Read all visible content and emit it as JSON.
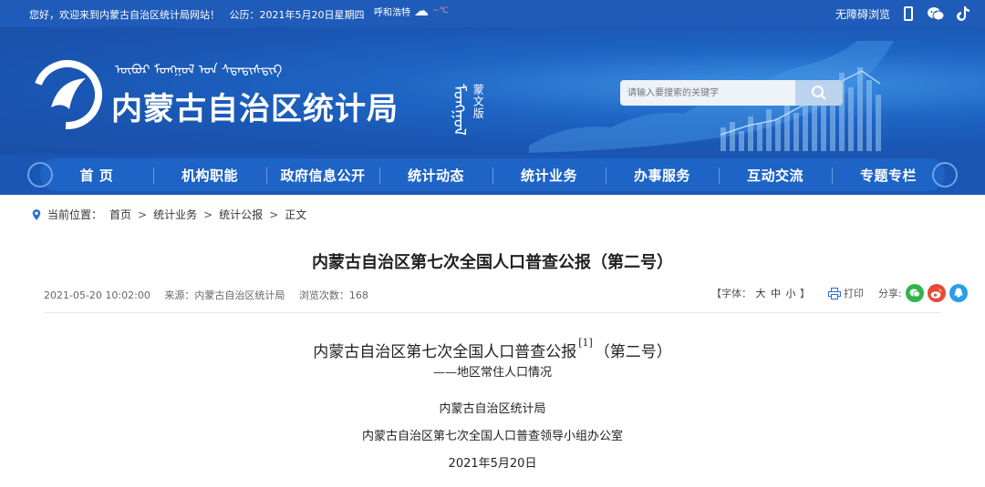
{
  "topbar": {
    "greeting": "您好，欢迎来到内蒙古自治区统计局网站！   公历：2021年5月20日星期四",
    "weather_city": "呼和浩特",
    "weather_temp": "~℃",
    "accessibility": "无障碍浏览",
    "icons": [
      "phone-icon",
      "wechat-icon",
      "tiktok-icon"
    ]
  },
  "header": {
    "mongolian_line": "ᠦᠪᠦᠷ ᠮᠣᠩᠭᠣᠯ ᠤᠨ ᠰᠲᠠᠲᠢᠰᠲᠢᠺ",
    "site_title": "内蒙古自治区统计局",
    "mongol_version_script": "ᠮᠣᠩᠭᠣᠯ",
    "mongol_version_label": "蒙文版",
    "search_placeholder": "请输入要搜索的关键字"
  },
  "nav": {
    "items": [
      "首 页",
      "机构职能",
      "政府信息公开",
      "统计动态",
      "统计业务",
      "办事服务",
      "互动交流",
      "专题专栏"
    ]
  },
  "breadcrumb": {
    "label": "当前位置：",
    "items": [
      "首页",
      "统计业务",
      "统计公报",
      "正文"
    ],
    "sep": ">"
  },
  "article": {
    "headline": "内蒙古自治区第七次全国人口普查公报（第二号）",
    "date": "2021-05-20 10:02:00",
    "source": "来源：内蒙古自治区统计局",
    "views": "浏览次数：168",
    "font_size_label": "【字体：",
    "font_sizes": [
      "大",
      "中",
      "小"
    ],
    "font_size_end": "】",
    "print_label": "打印",
    "share_label": "分享:",
    "doc_title": "内蒙古自治区第七次全国人口普查公报",
    "doc_title_note": "[1]",
    "doc_title_suffix": "（第二号）",
    "doc_subtitle": "——地区常住人口情况",
    "org1": "内蒙古自治区统计局",
    "org2": "内蒙古自治区第七次全国人口普查领导小组办公室",
    "doc_date": "2021年5月20日"
  },
  "colors": {
    "brand_blue": "#1a56b3",
    "nav_blue": "#1e63c6",
    "wechat_green": "#2fb54a",
    "weibo_red": "#e64a3c",
    "qq_blue": "#2a9ee8"
  }
}
